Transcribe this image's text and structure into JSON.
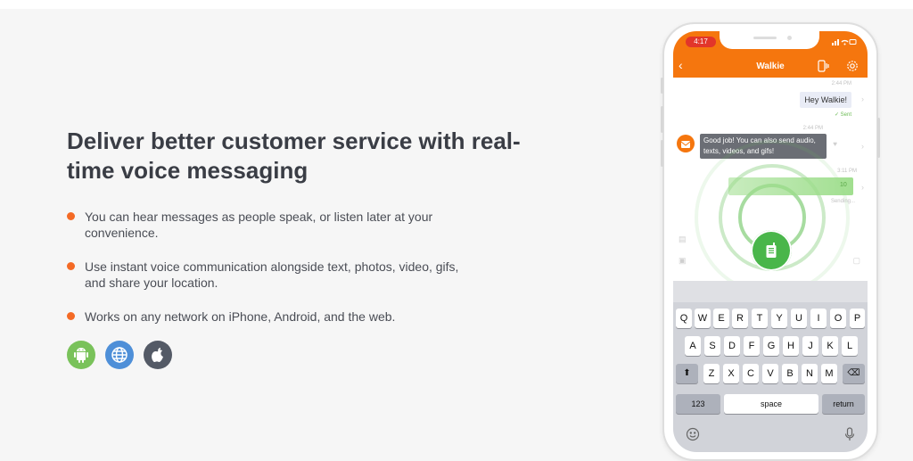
{
  "left": {
    "headline": "Deliver better customer service with real-time voice messaging",
    "bullets": [
      "You can hear messages as people speak, or listen later at your convenience.",
      "Use instant voice communication alongside text, photos, video, gifs, and share your location.",
      "Works on any network on iPhone, Android, and the web."
    ],
    "platform_icons": [
      "android-icon",
      "globe-icon",
      "apple-icon"
    ]
  },
  "phone": {
    "time": "4:17",
    "title": "Walkie",
    "messages": {
      "ts1": "2:44 PM",
      "out": "Hey Walkie!",
      "sent": "✓ Sent",
      "ts2": "2:44 PM",
      "in": "Good job! You can also send audio, texts, videos, and gifs!",
      "ts3": "3:11 PM",
      "voice": "10",
      "status": "Sending..."
    },
    "keyboard": {
      "row1": [
        "Q",
        "W",
        "E",
        "R",
        "T",
        "Y",
        "U",
        "I",
        "O",
        "P"
      ],
      "row2": [
        "A",
        "S",
        "D",
        "F",
        "G",
        "H",
        "J",
        "K",
        "L"
      ],
      "row3": [
        "Z",
        "X",
        "C",
        "V",
        "B",
        "N",
        "M"
      ],
      "numbers": "123",
      "space": "space",
      "return": "return"
    }
  },
  "colors": {
    "accent": "#f5760e",
    "bullet": "#f46a25",
    "talk_green": "#49b64a",
    "android": "#79c25a",
    "web": "#4e8fd8",
    "apple": "#545a66"
  }
}
